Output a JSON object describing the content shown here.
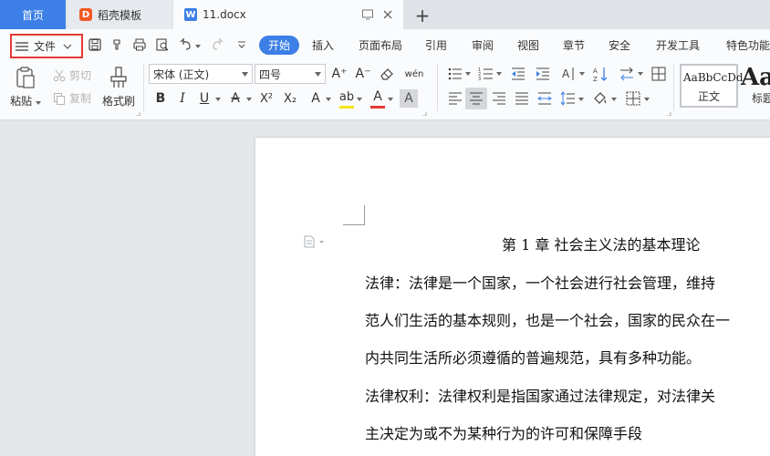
{
  "tabs": {
    "home": "首页",
    "docer": "稻壳模板",
    "docer_logo": "D",
    "file": "11.docx",
    "file_logo": "W",
    "add": "+"
  },
  "menu": {
    "file": "文件",
    "items": [
      "开始",
      "插入",
      "页面布局",
      "引用",
      "审阅",
      "视图",
      "章节",
      "安全",
      "开发工具",
      "特色功能"
    ]
  },
  "ribbon": {
    "paste": "粘贴",
    "cut": "剪切",
    "copy": "复制",
    "format_painter": "格式刷",
    "font_name": "宋体 (正文)",
    "font_size": "四号",
    "bold": "B",
    "italic": "I",
    "underline": "U",
    "strikethrough": "A",
    "superscript": "X²",
    "subscript": "X₂",
    "text_effect": "A",
    "highlight": "ab",
    "font_color": "A",
    "char_shading": "A",
    "grow_font": "A⁺",
    "shrink_font": "A⁻",
    "phonetic": "wén",
    "styles": [
      {
        "sample": "AaBbCcDd",
        "label": "正文"
      },
      {
        "sample": "Aa",
        "label": "标题"
      }
    ]
  },
  "colors": {
    "accent": "#3c7fe6",
    "highlight_marker": "#f5e51b",
    "font_color_marker": "#e53935",
    "file_border": "#e53935"
  },
  "document": {
    "title": "第 1 章  社会主义法的基本理论",
    "lines": [
      "法律：法律是一个国家，一个社会进行社会管理，维持",
      "范人们生活的基本规则，也是一个社会，国家的民众在一",
      "内共同生活所必须遵循的普遍规范，具有多种功能。",
      "法律权利：法律权利是指国家通过法律规定，对法律关",
      "主决定为或不为某种行为的许可和保障手段"
    ]
  }
}
